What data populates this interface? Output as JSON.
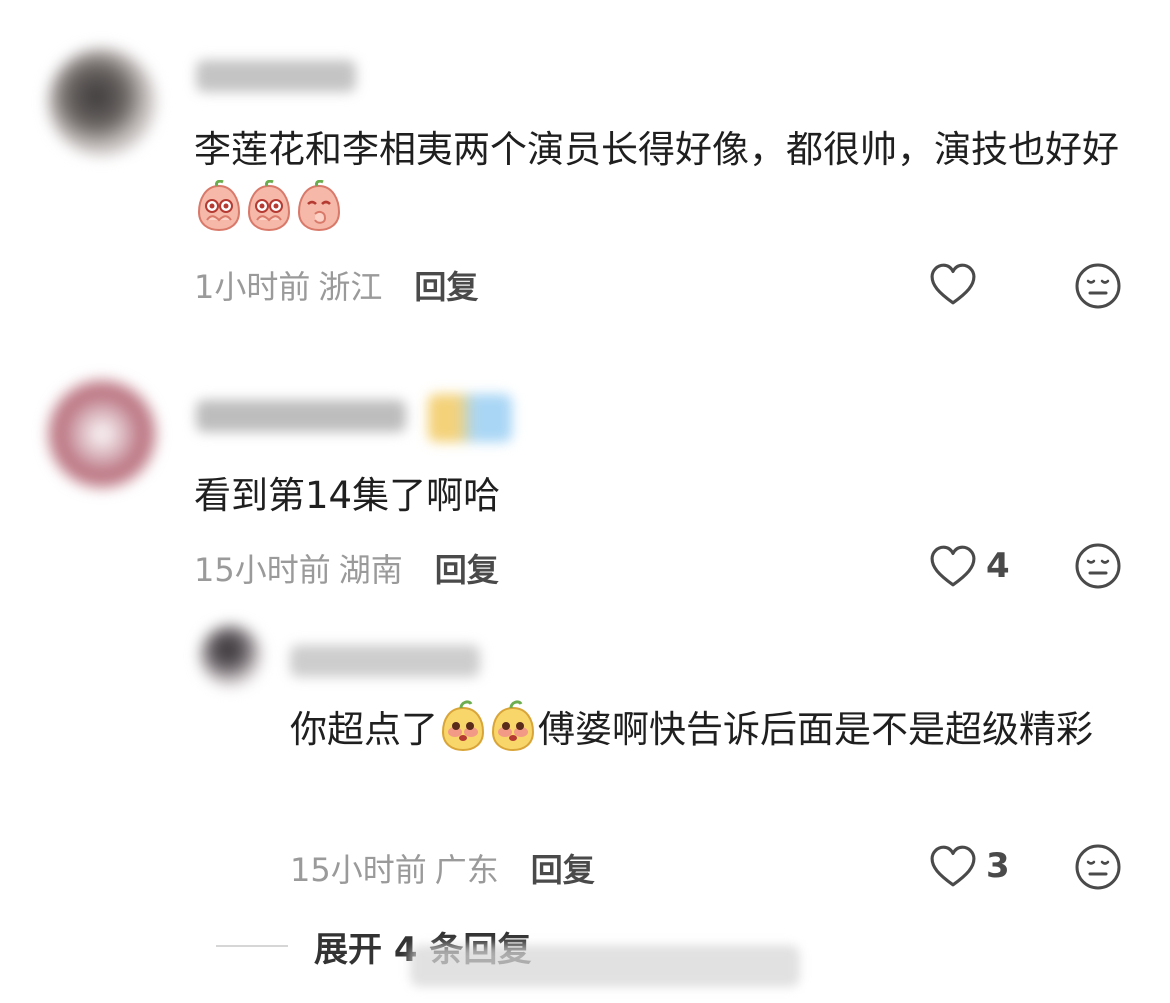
{
  "comments": [
    {
      "text": "李莲花和李相夷两个演员长得好像，都很帅，演技也好好",
      "emojis": [
        "peach-crying-emoji",
        "peach-crying-emoji",
        "peach-thinking-emoji"
      ],
      "time": "1小时前",
      "location": "浙江",
      "reply_label": "回复",
      "like_count": ""
    },
    {
      "text": "看到第14集了啊哈",
      "time": "15小时前",
      "location": "湖南",
      "reply_label": "回复",
      "like_count": "4"
    }
  ],
  "reply": {
    "text_before": "你超点了",
    "emojis": [
      "lemon-face-emoji",
      "lemon-face-emoji"
    ],
    "text_after": "傅婆啊快告诉后面是不是超级精彩",
    "time": "15小时前",
    "location": "广东",
    "reply_label": "回复",
    "like_count": "3"
  },
  "expand_label": "展开 4 条回复",
  "icons": {
    "like": "heart-outline-icon",
    "dislike": "neutral-face-icon"
  },
  "colors": {
    "meta_text": "#9a9a9a",
    "body_text": "#1f1f1f",
    "icon_stroke": "#4a4a4a"
  }
}
